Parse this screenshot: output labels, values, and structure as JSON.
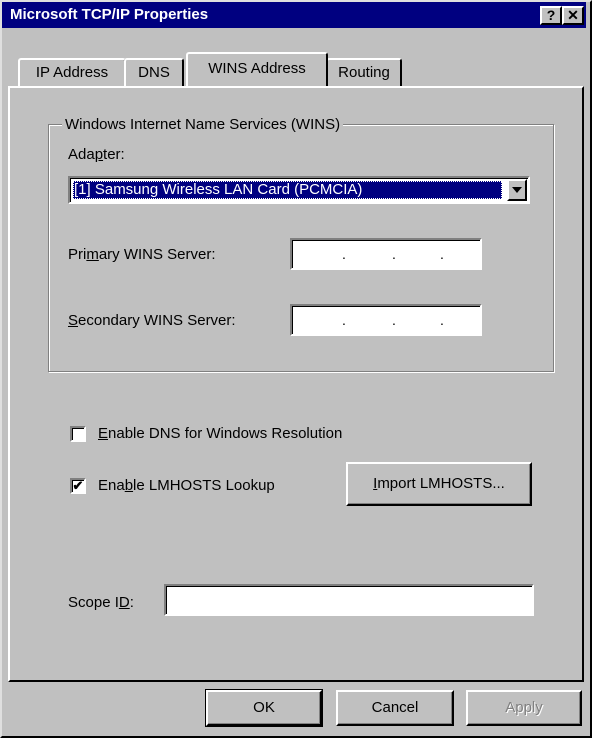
{
  "window": {
    "title": "Microsoft TCP/IP Properties",
    "help_glyph": "?",
    "close_glyph": "✕"
  },
  "tabs": [
    {
      "label": "IP Address"
    },
    {
      "label": "DNS"
    },
    {
      "label": "WINS Address",
      "active": true
    },
    {
      "label": "Routing"
    }
  ],
  "wins_group": {
    "label": "Windows Internet Name Services (WINS)",
    "adapter_label_pre": "Ada",
    "adapter_label_u": "p",
    "adapter_label_post": "ter:",
    "adapter_selected": "[1] Samsung Wireless LAN Card (PCMCIA)",
    "primary_label_pre": "Pri",
    "primary_label_u": "m",
    "primary_label_post": "ary WINS Server:",
    "primary_value": "",
    "secondary_label_u": "S",
    "secondary_label_post": "econdary WINS Server:",
    "secondary_value": ""
  },
  "options": {
    "enable_dns_pre": "",
    "enable_dns_u": "E",
    "enable_dns_post": "nable DNS for Windows Resolution",
    "enable_dns_checked": false,
    "lmhosts_pre": "Ena",
    "lmhosts_u": "b",
    "lmhosts_post": "le LMHOSTS Lookup",
    "lmhosts_checked": true,
    "import_pre": "",
    "import_u": "I",
    "import_post": "mport LMHOSTS..."
  },
  "scope": {
    "label_pre": "Scope I",
    "label_u": "D",
    "label_post": ":",
    "value": ""
  },
  "footer": {
    "ok": "OK",
    "cancel": "Cancel",
    "apply": "Apply"
  }
}
